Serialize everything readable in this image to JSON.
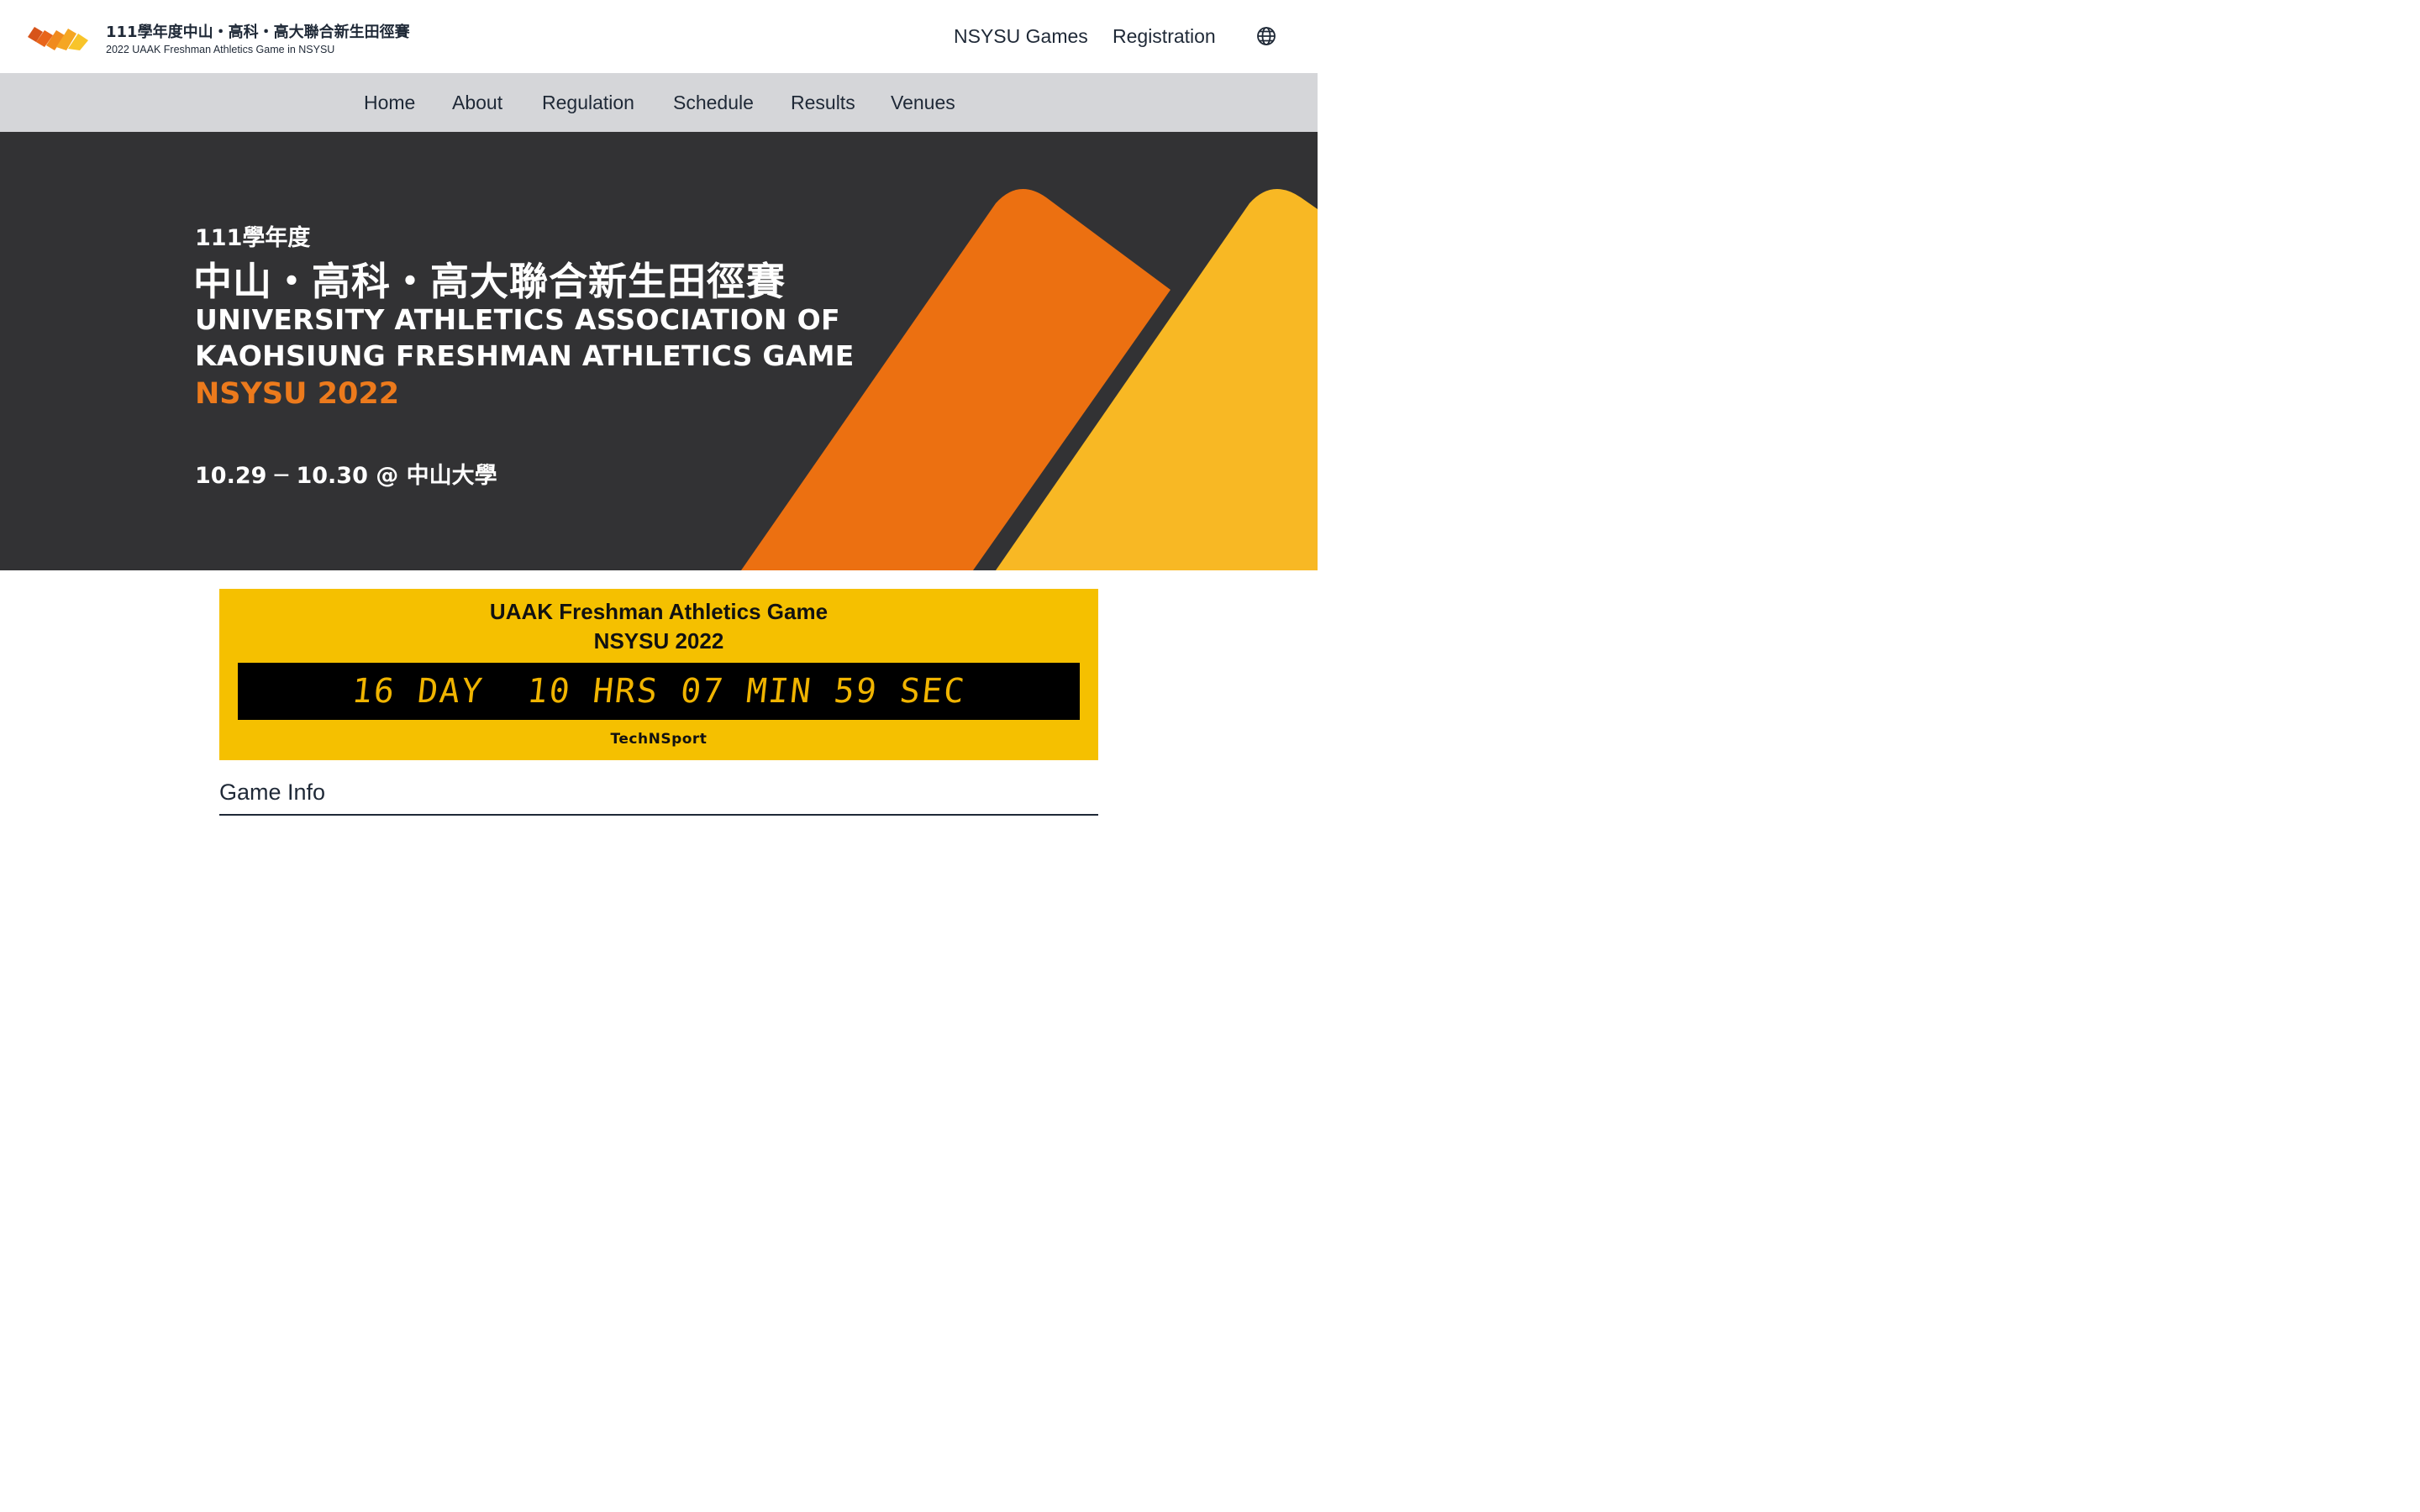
{
  "header": {
    "site_title": "111學年度中山・高科・高大聯合新生田徑賽",
    "site_subtitle": "2022 UAAK Freshman Athletics Game in NSYSU",
    "links": [
      "NSYSU Games",
      "Registration"
    ],
    "language_icon": "globe-icon"
  },
  "nav": {
    "items": [
      "Home",
      "About",
      "Regulation",
      "Schedule",
      "Results",
      "Venues"
    ]
  },
  "hero": {
    "year": "111學年度",
    "title_zh": "中山・高科・高大聯合新生田徑賽",
    "title_en_line1": "UNIVERSITY ATHLETICS ASSOCIATION OF",
    "title_en_line2": "KAOHSIUNG FRESHMAN ATHLETICS GAME",
    "highlight": "NSYSU 2022",
    "date": "10.29 ─ 10.30  @ 中山大學"
  },
  "countdown": {
    "title_line1": "UAAK Freshman Athletics Game",
    "title_line2": "NSYSU 2022",
    "display": "16 DAY  10 HRS 07 MIN 59 SEC",
    "brand": "TechNSport"
  },
  "game_info": {
    "heading": "Game Info"
  },
  "colors": {
    "accent_orange": "#ec7a1c",
    "accent_yellow": "#f8b824",
    "hero_bg": "#323234",
    "nav_bg": "#d5d6d9",
    "countdown_bg": "#f5c000"
  }
}
